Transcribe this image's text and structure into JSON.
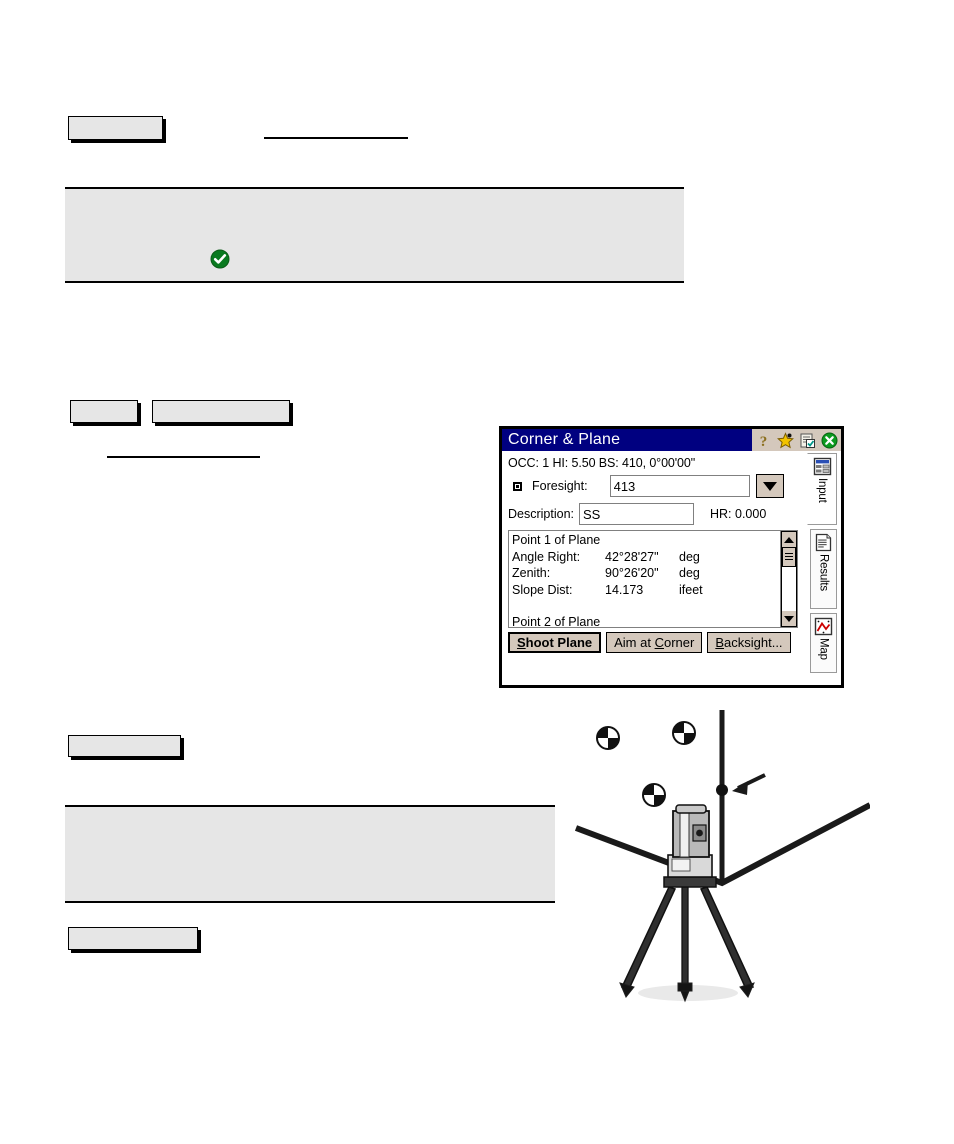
{
  "page": {
    "background": "#ffffff",
    "redacted_note": "text content blanked in source page"
  },
  "placeholders": {
    "button_top": "",
    "rule_top": "",
    "panel_top": "",
    "button_mid_left": "",
    "button_mid_right": "",
    "rule_mid": "",
    "button_lower": "",
    "panel_lower": "",
    "button_bottom": ""
  },
  "icons": {
    "success_check": "green-check-icon",
    "help": "help-question-icon",
    "favorite": "star-icon",
    "document_check": "document-check-icon",
    "close": "close-x-icon"
  },
  "pda": {
    "title": "Corner & Plane",
    "title_colors": {
      "bar": "#000080",
      "text": "#ffffff",
      "icons_bg": "#d4c8bc"
    },
    "status_line": "OCC: 1  HI: 5.50  BS: 410, 0°00'00\"",
    "foresight": {
      "label": "Foresight:",
      "value": "413",
      "placeholder": "",
      "dropdown": "chevron-down-icon"
    },
    "description": {
      "label": "Description:",
      "value": "SS",
      "placeholder": ""
    },
    "hr": {
      "label": "HR: 0.000"
    },
    "list": {
      "header": "Point 1 of Plane",
      "rows": [
        {
          "name": "Angle Right:",
          "value": "42°28'27\"",
          "unit": "deg"
        },
        {
          "name": "Zenith:",
          "value": "90°26'20\"",
          "unit": "deg"
        },
        {
          "name": "Slope Dist:",
          "value": "14.173",
          "unit": "ifeet"
        }
      ],
      "next_header": "Point 2 of Plane"
    },
    "buttons": [
      {
        "label": "Shoot Plane",
        "accel": "S",
        "default": true
      },
      {
        "label": "Aim at Corner",
        "accel": "C",
        "default": false
      },
      {
        "label": "Backsight...",
        "accel": "B",
        "default": false
      }
    ],
    "tabs": [
      {
        "label": "Input",
        "icon": "input-form-icon",
        "active": true
      },
      {
        "label": "Results",
        "icon": "results-doc-icon",
        "active": false
      },
      {
        "label": "Map",
        "icon": "map-icon",
        "active": false
      }
    ]
  },
  "diagram": {
    "name": "total-station-corner-plane-illustration",
    "elements": [
      "total-station-instrument",
      "tripod",
      "survey-target-1",
      "survey-target-2",
      "survey-target-3",
      "corner-vertical-line",
      "corner-point-dot",
      "pointer-arrow",
      "wall-left",
      "wall-right"
    ]
  }
}
